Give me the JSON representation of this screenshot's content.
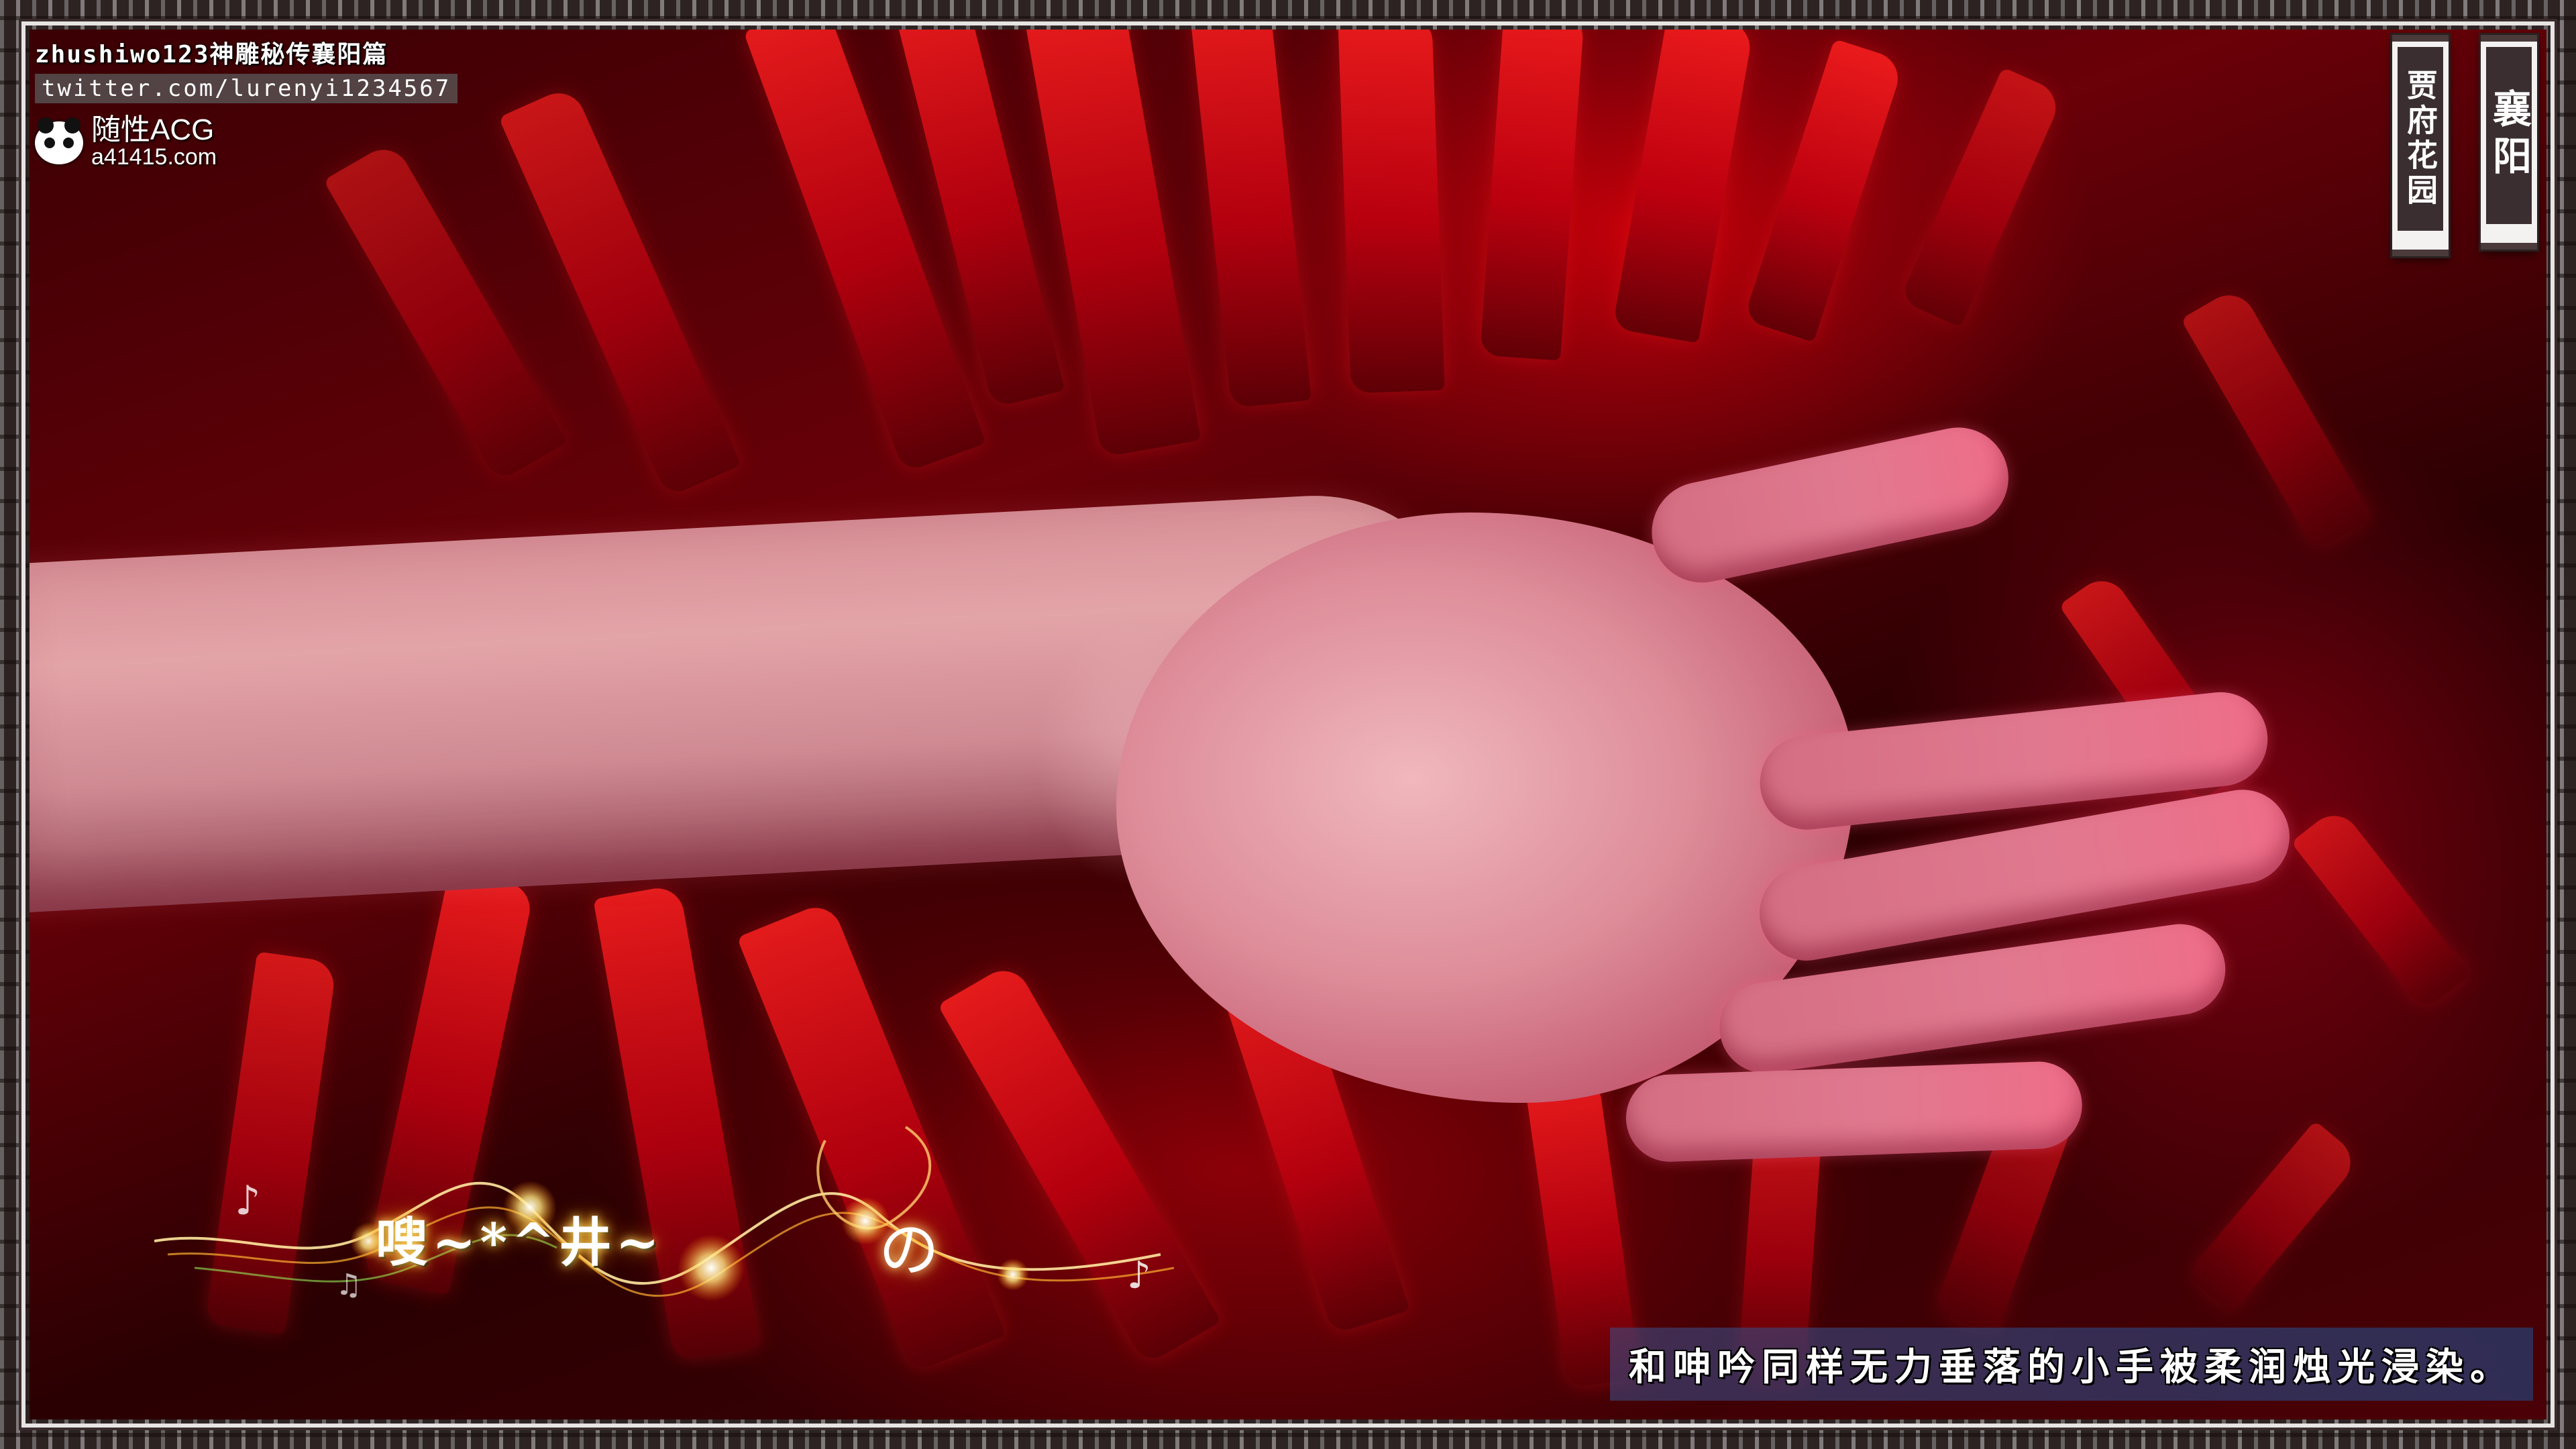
{
  "watermark": {
    "line1": "zhushiwo123神雕秘传襄阳篇",
    "line2": "twitter.com/lurenyi1234567",
    "brand_name": "随性ACG",
    "brand_url": "a41415.com",
    "brand_icon": "panda-icon"
  },
  "location": {
    "main": "襄阳",
    "sub": "贾府花园"
  },
  "subtitle": {
    "text": "和呻吟同样无力垂落的小手被柔润烛光浸染。"
  },
  "sparkle_logo": {
    "text": "嗖~*^井~",
    "suffix": "の"
  },
  "colors": {
    "background_red": "#c4000a",
    "border_line": "#e8e4e4",
    "plaque_dark": "#3a2e30"
  }
}
